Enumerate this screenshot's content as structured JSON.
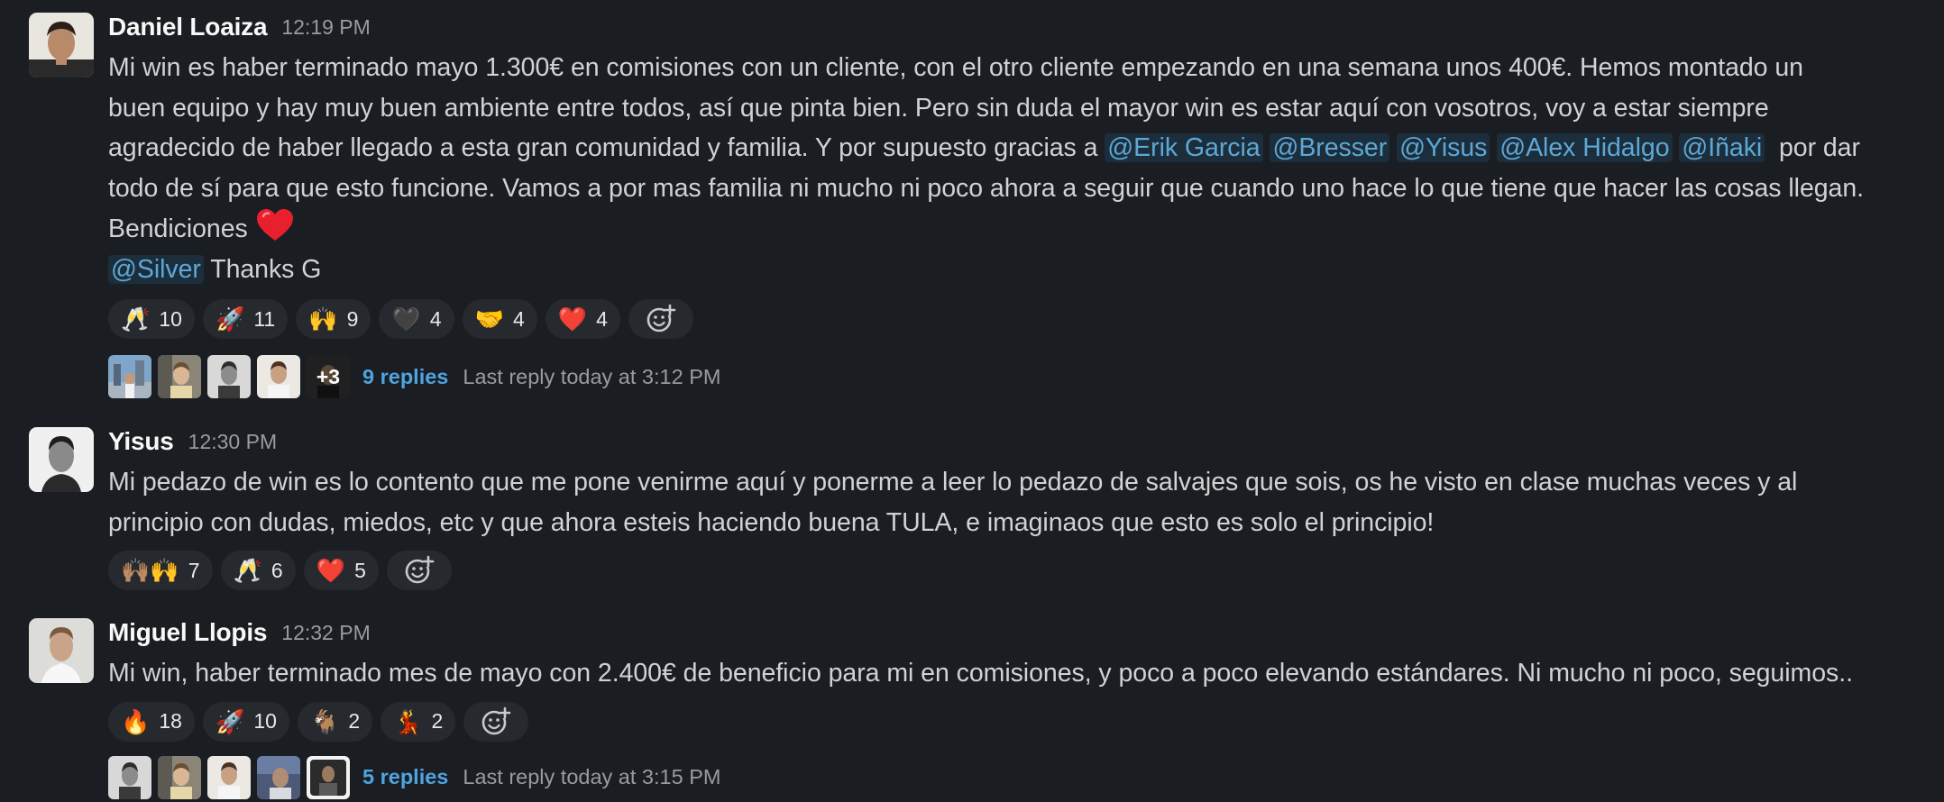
{
  "messages": [
    {
      "author": "Daniel Loaiza",
      "time": "12:19 PM",
      "text": {
        "l1": "Mi win es haber terminado mayo 1.300€ en comisiones con un cliente, con el otro cliente empezando en una semana unos 400€. Hemos montado un",
        "l2": "buen equipo y hay muy buen ambiente entre todos, así que pinta bien. Pero sin duda el mayor win es estar aquí con vosotros, voy a estar siempre",
        "l3_pre": "agradecido de haber llegado a esta gran comunidad y familia. Y por supuesto gracias a",
        "mentions": [
          "@Erik Garcia",
          "@Bresser",
          "@Yisus",
          "@Alex Hidalgo",
          "@Iñaki"
        ],
        "l3_post": "por dar",
        "l4": "todo de sí para que esto funcione. Vamos a por mas familia ni mucho ni poco ahora a seguir que cuando uno hace lo que tiene que hacer las cosas llegan.",
        "l5": "Bendiciones",
        "l6_mention": "@Silver",
        "l6_text": "Thanks G"
      },
      "reactions": [
        {
          "emoji": "🥂",
          "count": "10"
        },
        {
          "emoji": "🚀",
          "count": "11"
        },
        {
          "emoji": "🙌",
          "count": "9"
        },
        {
          "emoji": "🖤",
          "count": "4"
        },
        {
          "emoji": "🤝",
          "count": "4"
        },
        {
          "emoji": "❤️",
          "count": "4"
        }
      ],
      "thread": {
        "more": "+3",
        "replies": "9 replies",
        "last_reply": "Last reply today at 3:12 PM"
      }
    },
    {
      "author": "Yisus",
      "time": "12:30 PM",
      "text": {
        "l1": "Mi pedazo de win es lo contento que me pone venirme aquí y ponerme a leer lo pedazo de salvajes que sois, os he visto en clase muchas veces y al",
        "l2": "principio con dudas, miedos, etc y que ahora esteis haciendo buena TULA, e imaginaos que esto es solo el principio!"
      },
      "reactions": [
        {
          "emoji": "🙌🏽🙌",
          "count": "7"
        },
        {
          "emoji": "🥂",
          "count": "6"
        },
        {
          "emoji": "❤️",
          "count": "5"
        }
      ]
    },
    {
      "author": "Miguel Llopis",
      "time": "12:32 PM",
      "text": {
        "l1": "Mi win, haber terminado mes de mayo con 2.400€ de beneficio para mi en comisiones, y poco a poco elevando estándares. Ni mucho ni poco, seguimos.."
      },
      "reactions": [
        {
          "emoji": "🔥",
          "count": "18"
        },
        {
          "emoji": "🚀",
          "count": "10"
        },
        {
          "emoji": "🐐",
          "count": "2"
        },
        {
          "emoji": "💃",
          "count": "2"
        }
      ],
      "thread": {
        "replies": "5 replies",
        "last_reply": "Last reply today at 3:15 PM"
      }
    }
  ]
}
